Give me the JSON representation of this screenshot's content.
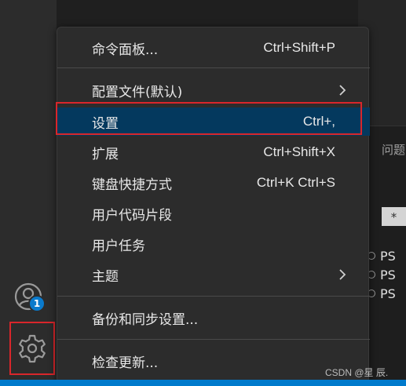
{
  "menu": {
    "items": [
      {
        "label": "命令面板...",
        "shortcut": "Ctrl+Shift+P"
      },
      {
        "label": "配置文件(默认)",
        "submenu": true
      },
      {
        "label": "设置",
        "shortcut": "Ctrl+,",
        "selected": true
      },
      {
        "label": "扩展",
        "shortcut": "Ctrl+Shift+X"
      },
      {
        "label": "键盘快捷方式",
        "shortcut": "Ctrl+K Ctrl+S"
      },
      {
        "label": "用户代码片段"
      },
      {
        "label": "用户任务"
      },
      {
        "label": "主题",
        "submenu": true
      },
      {
        "label": "备份和同步设置..."
      },
      {
        "label": "检查更新..."
      }
    ]
  },
  "activity_bar": {
    "account_badge": "1",
    "icons": [
      "account-icon",
      "gear-icon"
    ]
  },
  "panel": {
    "title": "问题",
    "chip": "*",
    "ps_rows": [
      "PS",
      "PS",
      "PS"
    ]
  },
  "watermark": "CSDN @星 辰.",
  "colors": {
    "accent": "#007acc",
    "selection": "#04395e",
    "highlight_outline": "#d9262b",
    "menu_bg": "#2c2c2c"
  }
}
